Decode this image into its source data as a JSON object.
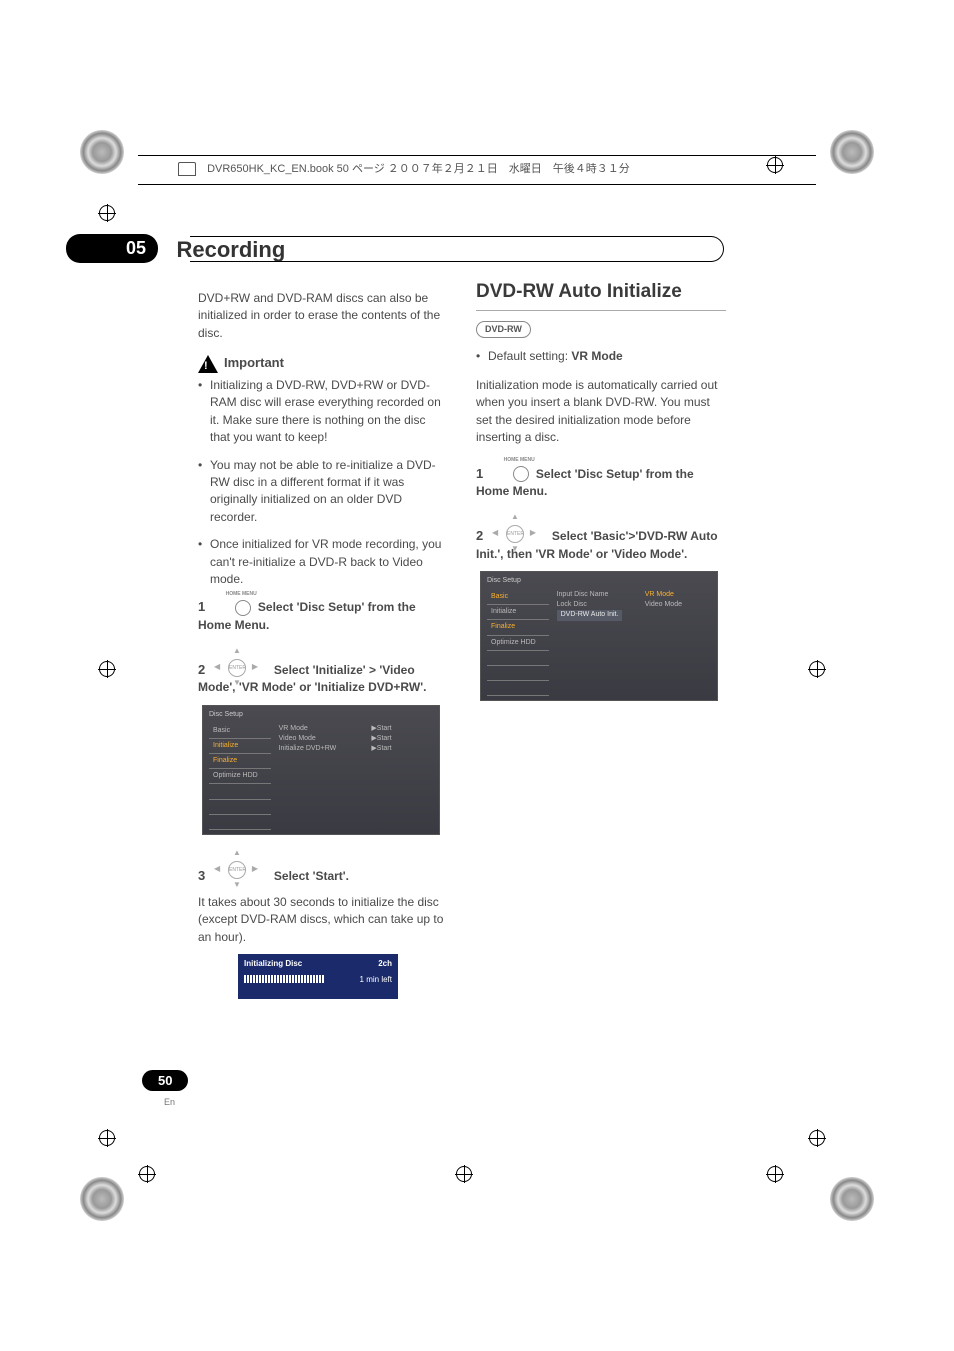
{
  "header": {
    "line": "DVR650HK_KC_EN.book  50 ページ  ２００７年２月２１日　水曜日　午後４時３１分"
  },
  "chapter": {
    "num": "05",
    "title": "Recording"
  },
  "left": {
    "intro": "DVD+RW and DVD-RAM discs can also be initialized in order to erase the contents of the disc.",
    "important_label": "Important",
    "bullets": [
      "Initializing a DVD-RW, DVD+RW or DVD-RAM disc will erase everything recorded on it. Make sure there is nothing on the disc that you want to keep!",
      "You may not be able to re-initialize a DVD-RW disc in a different format if it was originally initialized on an older DVD recorder.",
      "Once initialized for VR mode recording, you can't re-initialize a DVD-R back to Video mode."
    ],
    "step1_num": "1",
    "step1": "Select 'Disc Setup' from the Home Menu.",
    "step2_num": "2",
    "step2": "Select 'Initialize' > 'Video Mode', 'VR Mode' or 'Initialize DVD+RW'.",
    "step3_num": "3",
    "step3": "Select 'Start'.",
    "step3_after": "It takes about 30 seconds to initialize the disc (except DVD-RAM discs, which can take up to an hour).",
    "menu1": {
      "title": "Disc Setup",
      "col1": [
        "Basic",
        "Initialize",
        "Finalize",
        "Optimize HDD"
      ],
      "col2": [
        "VR Mode",
        "Video Mode",
        "Initialize DVD+RW"
      ],
      "col3": [
        "▶Start",
        "▶Start",
        "▶Start"
      ]
    },
    "progress": {
      "title": "Initializing Disc",
      "ch": "2ch",
      "time": "1 min left"
    }
  },
  "right": {
    "heading": "DVD-RW Auto Initialize",
    "badge": "DVD-RW",
    "default_label": "Default setting: ",
    "default_value": "VR Mode",
    "body": "Initialization mode is automatically carried out when you insert a blank DVD-RW. You must set the desired initialization mode before inserting a disc.",
    "step1_num": "1",
    "step1": "Select 'Disc Setup' from the Home Menu.",
    "step2_num": "2",
    "step2": "Select 'Basic'>'DVD-RW Auto Init.', then 'VR Mode' or 'Video Mode'.",
    "menu2": {
      "title": "Disc Setup",
      "col1": [
        "Basic",
        "Initialize",
        "Finalize",
        "Optimize HDD"
      ],
      "col2": [
        "Input Disc Name",
        "Lock Disc",
        "DVD-RW Auto Init."
      ],
      "col3": [
        "VR Mode",
        "Video Mode"
      ]
    }
  },
  "footer": {
    "page": "50",
    "lang": "En"
  },
  "icons": {
    "home_menu": "HOME MENU",
    "enter": "ENTER"
  }
}
